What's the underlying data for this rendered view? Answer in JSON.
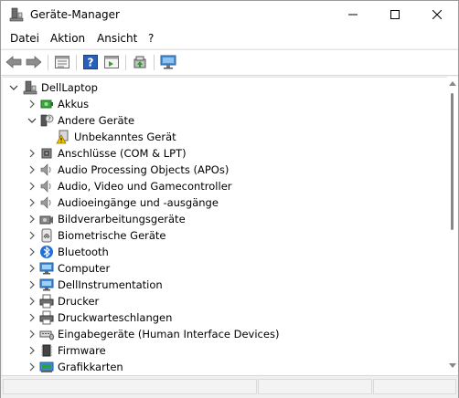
{
  "window": {
    "title": "Geräte-Manager",
    "app_icon": "device-manager-icon"
  },
  "menu": [
    {
      "label": "Datei"
    },
    {
      "label": "Aktion"
    },
    {
      "label": "Ansicht"
    },
    {
      "label": "?"
    }
  ],
  "toolbar": {
    "buttons": [
      "back-arrow-icon",
      "forward-arrow-icon",
      "properties-icon",
      "help-icon",
      "action-view-icon",
      "update-driver-icon",
      "scan-hardware-icon"
    ]
  },
  "tree": {
    "root": "DellLaptop",
    "items": [
      {
        "label": "Akkus",
        "icon": "battery-icon",
        "expanded": false
      },
      {
        "label": "Andere Geräte",
        "icon": "other-devices-icon",
        "expanded": true
      },
      {
        "label": "Unbekanntes Gerät",
        "icon": "unknown-device-warning-icon",
        "child": true
      },
      {
        "label": "Anschlüsse (COM & LPT)",
        "icon": "port-icon",
        "expanded": false
      },
      {
        "label": "Audio Processing Objects (APOs)",
        "icon": "speaker-icon",
        "expanded": false
      },
      {
        "label": "Audio, Video und Gamecontroller",
        "icon": "speaker-icon",
        "expanded": false
      },
      {
        "label": "Audioeingänge und -ausgänge",
        "icon": "speaker-icon",
        "expanded": false
      },
      {
        "label": "Bildverarbeitungsgeräte",
        "icon": "camera-icon",
        "expanded": false
      },
      {
        "label": "Biometrische Geräte",
        "icon": "fingerprint-icon",
        "expanded": false
      },
      {
        "label": "Bluetooth",
        "icon": "bluetooth-icon",
        "expanded": false
      },
      {
        "label": "Computer",
        "icon": "monitor-icon",
        "expanded": false
      },
      {
        "label": "DellInstrumentation",
        "icon": "monitor-icon",
        "expanded": false
      },
      {
        "label": "Drucker",
        "icon": "printer-icon",
        "expanded": false
      },
      {
        "label": "Druckwarteschlangen",
        "icon": "printer-icon",
        "expanded": false
      },
      {
        "label": "Eingabegeräte (Human Interface Devices)",
        "icon": "hid-icon",
        "expanded": false
      },
      {
        "label": "Firmware",
        "icon": "firmware-chip-icon",
        "expanded": false
      },
      {
        "label": "Grafikkarten",
        "icon": "display-adapter-icon",
        "expanded": false
      }
    ]
  },
  "colors": {
    "accent": "#1e88e5",
    "warning": "#f2c200"
  }
}
